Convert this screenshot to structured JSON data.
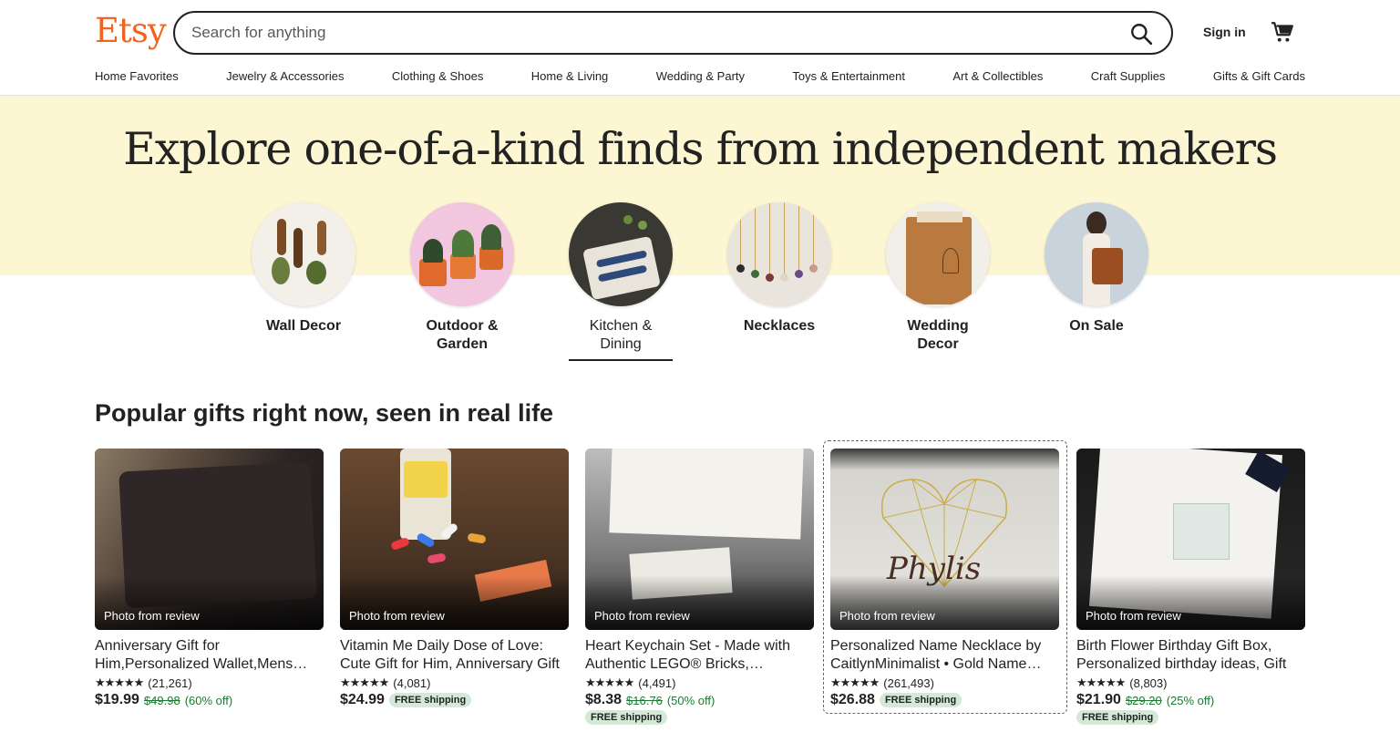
{
  "header": {
    "logo": "Etsy",
    "search_placeholder": "Search for anything",
    "signin": "Sign in"
  },
  "nav": [
    "Home Favorites",
    "Jewelry & Accessories",
    "Clothing & Shoes",
    "Home & Living",
    "Wedding & Party",
    "Toys & Entertainment",
    "Art & Collectibles",
    "Craft Supplies",
    "Gifts & Gift Cards"
  ],
  "hero": {
    "title": "Explore one-of-a-kind finds from independent makers"
  },
  "categories": [
    {
      "label": "Wall Decor"
    },
    {
      "label": "Outdoor & Garden"
    },
    {
      "label": "Kitchen & Dining"
    },
    {
      "label": "Necklaces"
    },
    {
      "label": "Wedding Decor"
    },
    {
      "label": "On Sale"
    }
  ],
  "popular": {
    "title": "Popular gifts right now, seen in real life",
    "photo_label": "Photo from review",
    "stars": "★★★★★",
    "items": [
      {
        "title": "Anniversary Gift for Him,Personalized Wallet,Mens Leather Wallet",
        "reviews": "(21,261)",
        "price": "$19.99",
        "orig": "$49.98",
        "off": "(60% off)",
        "shipping": ""
      },
      {
        "title": "Vitamin Me Daily Dose of Love: Cute Gift for Him, Anniversary Gift",
        "reviews": "(4,081)",
        "price": "$24.99",
        "orig": "",
        "off": "",
        "shipping": "FREE shipping"
      },
      {
        "title": "Heart Keychain Set - Made with Authentic LEGO® Bricks, Friendship",
        "reviews": "(4,491)",
        "price": "$8.38",
        "orig": "$16.76",
        "off": "(50% off)",
        "shipping": "FREE shipping"
      },
      {
        "title": "Personalized Name Necklace by CaitlynMinimalist • Gold Name Necklace",
        "reviews": "(261,493)",
        "price": "$26.88",
        "orig": "",
        "off": "",
        "shipping": "FREE shipping"
      },
      {
        "title": "Birth Flower Birthday Gift Box, Personalized birthday ideas, Gift",
        "reviews": "(8,803)",
        "price": "$21.90",
        "orig": "$29.20",
        "off": "(25% off)",
        "shipping": "FREE shipping"
      }
    ]
  },
  "colors": {
    "brand": "#f1641e",
    "hero_bg": "#fdf6d3",
    "discount": "#1c7a32",
    "shipping_badge": "#d4e9d7"
  }
}
